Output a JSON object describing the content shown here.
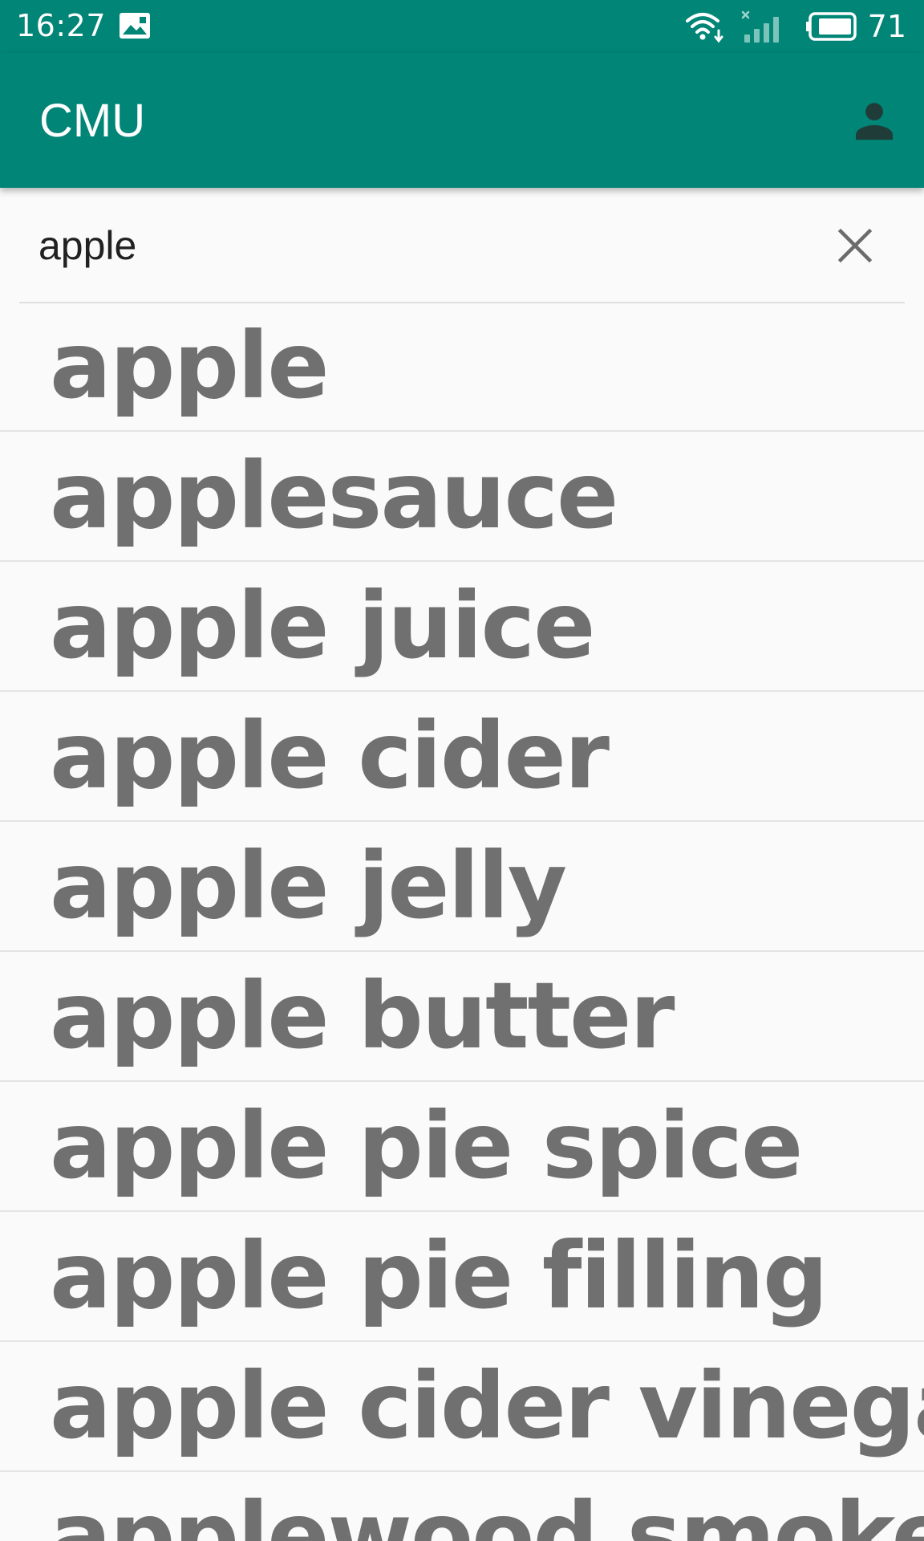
{
  "status_bar": {
    "time": "16:27",
    "battery_level": "71",
    "icons": [
      "gallery-notification-icon",
      "wifi-icon",
      "signal-icon",
      "battery-icon"
    ]
  },
  "app_bar": {
    "title": "CMU",
    "account_icon": "account-icon",
    "background_color": "#008577"
  },
  "search": {
    "value": "apple",
    "clear_icon": "close-icon"
  },
  "suggestions": [
    "apple",
    "applesauce",
    "apple juice",
    "apple cider",
    "apple jelly",
    "apple butter",
    "apple pie spice",
    "apple pie filling",
    "apple cider vinegar",
    "applewood smoked"
  ]
}
